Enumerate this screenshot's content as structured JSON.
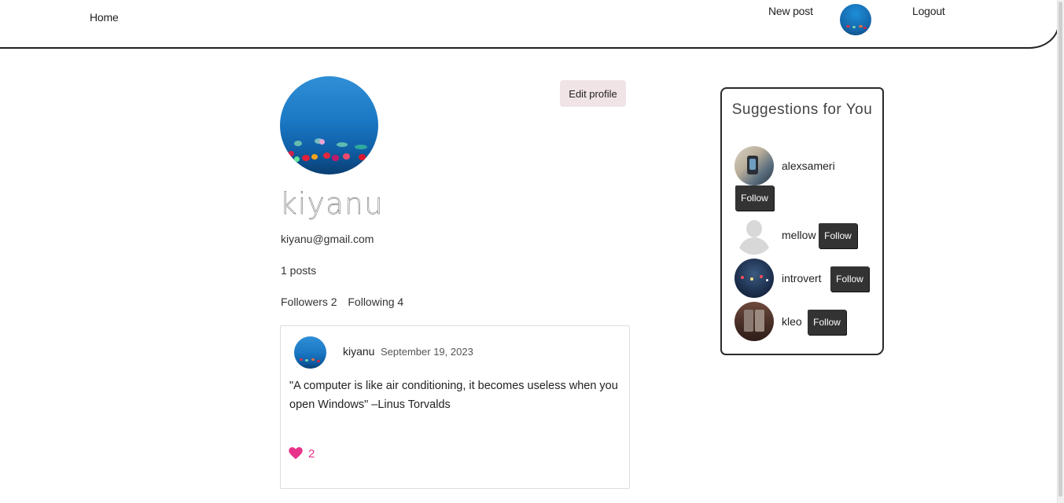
{
  "nav": {
    "home": "Home",
    "new_post": "New post",
    "logout": "Logout"
  },
  "profile": {
    "edit_label": "Edit profile",
    "username": "kiyanu",
    "email": "kiyanu@gmail.com",
    "posts": "1 posts",
    "followers": "Followers 2",
    "following": "Following 4"
  },
  "post": {
    "username": "kiyanu",
    "date": "September 19, 2023",
    "body": "\"A computer is like air conditioning, it becomes useless when you open Windows\" –Linus Torvalds",
    "likes": "2"
  },
  "suggestions": {
    "title": "Suggestions for You",
    "follow_label": "Follow",
    "users": [
      {
        "name": "alexsameri"
      },
      {
        "name": "mellow"
      },
      {
        "name": "introvert"
      },
      {
        "name": "kleo"
      }
    ]
  },
  "colors": {
    "like": "#e8338b",
    "edit_bg": "#f1e4e6",
    "follow_bg": "#333333"
  }
}
